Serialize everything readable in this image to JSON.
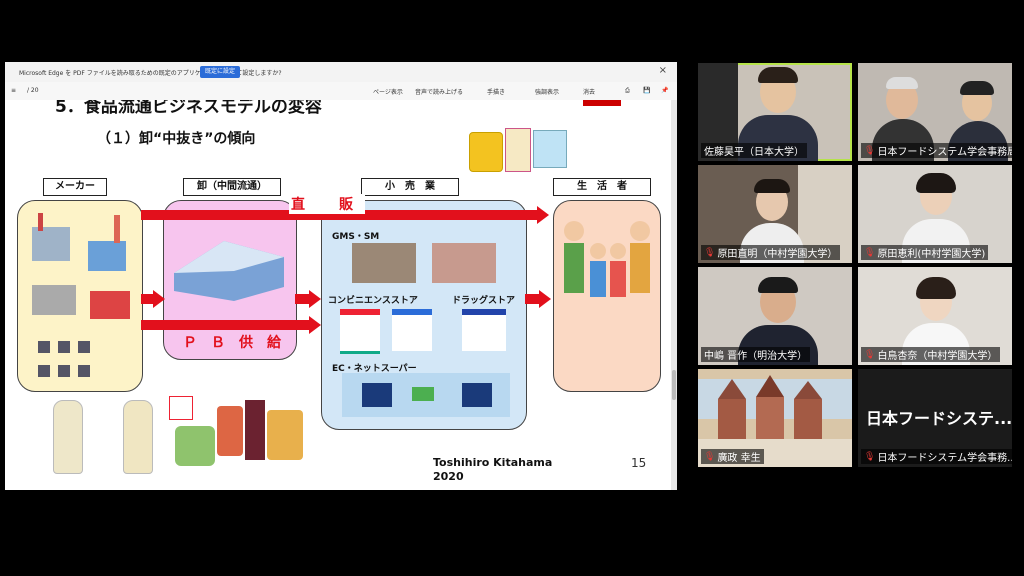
{
  "notification": {
    "text": "Microsoft Edge を PDF ファイルを読み取るための既定のアプリケーションとして設定しますか?",
    "button": "既定に設定"
  },
  "pdf_toolbar": {
    "page": "/ 20",
    "items": [
      "ページ表示",
      "音声で読み上げる",
      "手描き",
      "強調表示",
      "消去"
    ]
  },
  "slide": {
    "title": "5．食品流通ビジネスモデルの変容",
    "subtitle": "（１）卸“中抜き”の傾向",
    "headers": [
      "メーカー",
      "卸（中間流通）",
      "小　売　業",
      "生　活　者"
    ],
    "direct_sales": "直　販",
    "pb_supply": "ＰＢ供給",
    "retail_labels": [
      "GMS・SM",
      "コンビニエンスストア",
      "ドラッグストア",
      "EC・ネットスーパー"
    ],
    "author": "Toshihiro Kitahama",
    "year": "2020",
    "page_number": "15"
  },
  "participants": [
    {
      "name": "佐藤昊平（日本大学）",
      "muted": false
    },
    {
      "name": "日本フードシステム学会事務局",
      "muted": true
    },
    {
      "name": "原田直明（中村学園大学）",
      "muted": true
    },
    {
      "name": "原田恵利(中村学園大学)",
      "muted": true
    },
    {
      "name": "中嶋 晋作（明治大学）",
      "muted": false
    },
    {
      "name": "白鳥杏奈（中村学園大学）",
      "muted": true
    },
    {
      "name": "廣政 幸生",
      "muted": true
    },
    {
      "name": "日本フードシステム学会事務...",
      "muted": true
    }
  ],
  "placeholder_tile_text": "日本フードシステ...",
  "colors": {
    "active_speaker": "#b6e34a",
    "red_arrow": "#e2101c",
    "maker_box": "#fdf3c8",
    "wholesale_box": "#f7c5ee",
    "retail_box": "#d3e7f7",
    "consumer_box": "#fbd9c4"
  }
}
